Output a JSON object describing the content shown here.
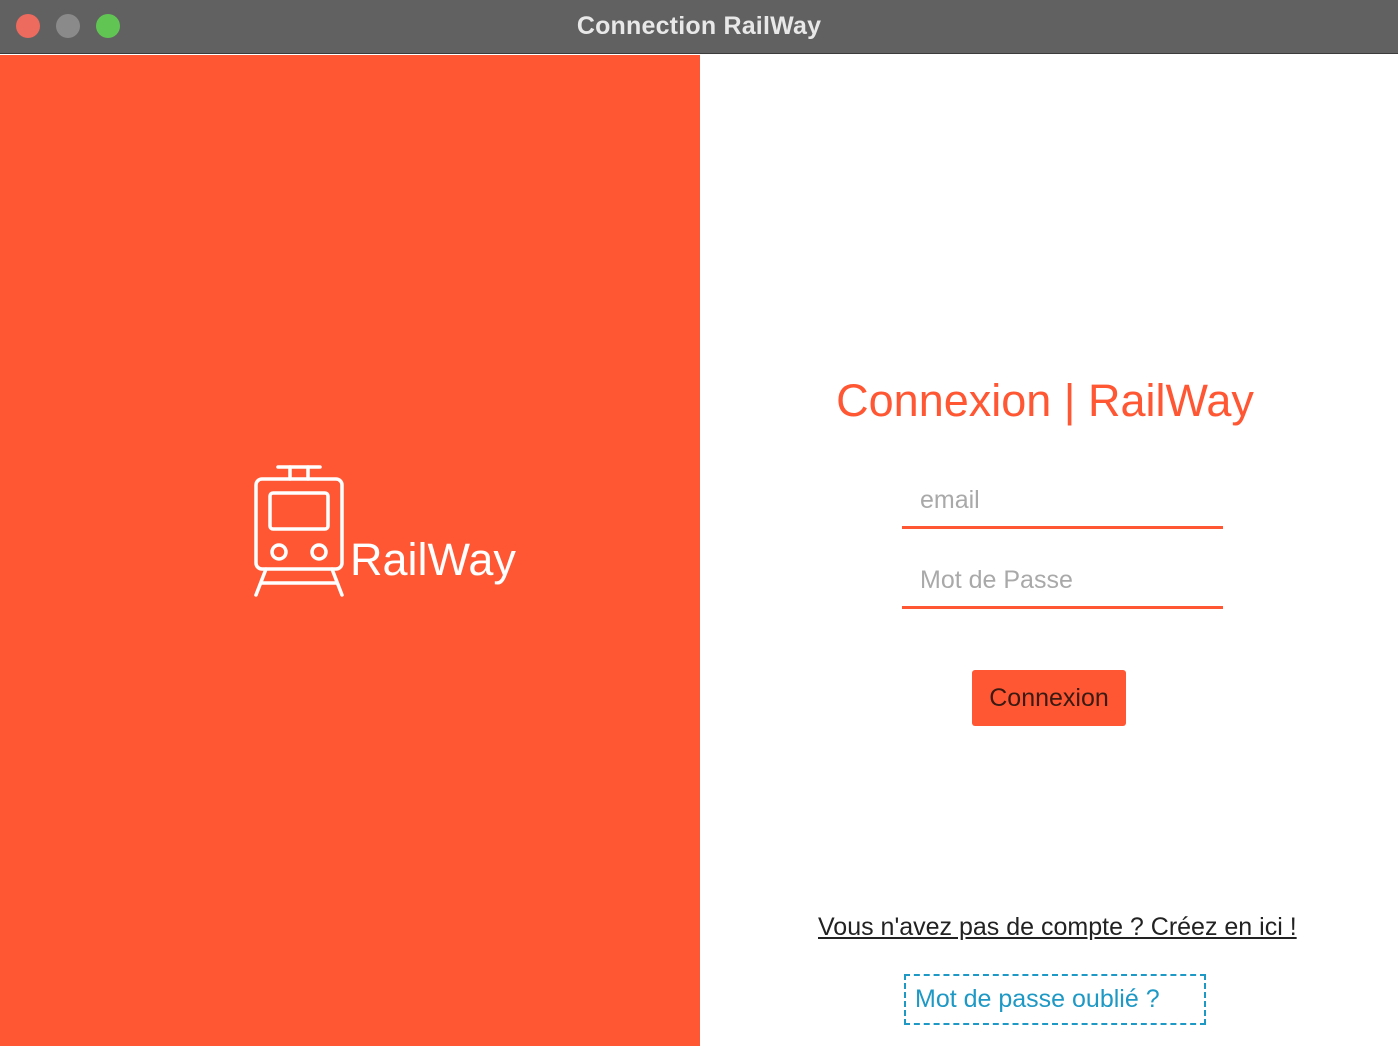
{
  "window": {
    "title": "Connection RailWay",
    "controls": [
      "close",
      "minimize",
      "maximize"
    ]
  },
  "brand": {
    "name": "RailWay",
    "icon": "train-icon",
    "panel_color": "#ff5733"
  },
  "login": {
    "title": "Connexion | RailWay",
    "email": {
      "placeholder": "email",
      "value": ""
    },
    "password": {
      "placeholder": "Mot de Passe",
      "value": ""
    },
    "submit_label": "Connexion",
    "signup_link": "Vous n'avez pas de compte ? Créez en ici !",
    "forgot_link": "Mot de passe oublié ?"
  },
  "colors": {
    "accent": "#ff5733",
    "link_focus": "#1e98c4",
    "titlebar": "#616161"
  }
}
